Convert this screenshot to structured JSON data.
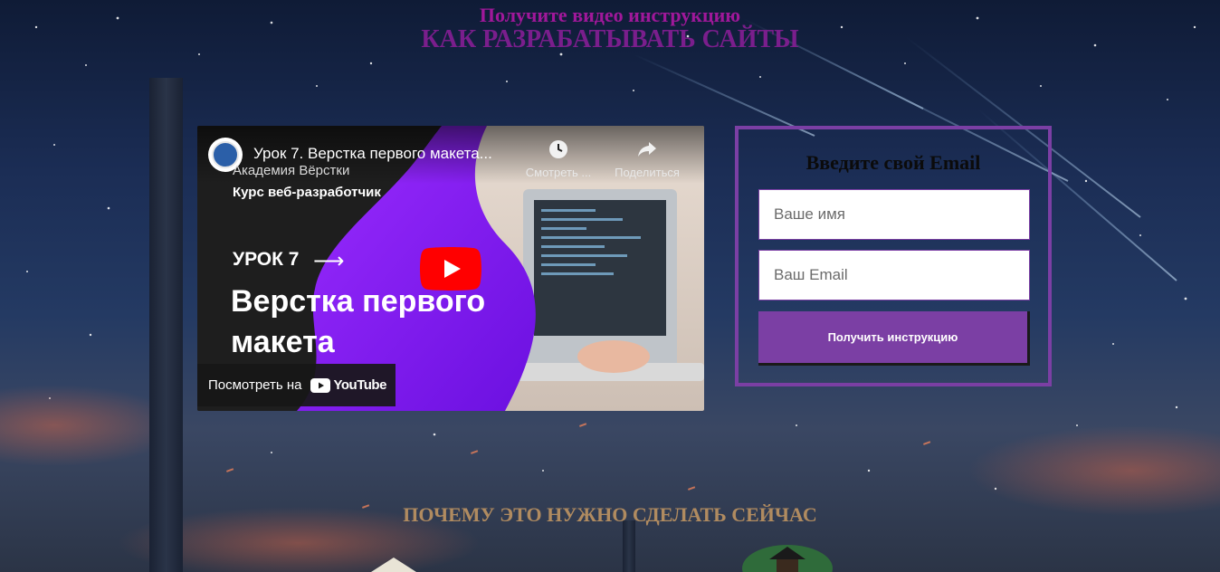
{
  "header": {
    "subtitle": "Получите видео инструкцию",
    "title": "КАК РАЗРАБАТЫВАТЬ САЙТЫ"
  },
  "video": {
    "title": "Урок 7. Верстка первого макета...",
    "channel": "Академия Вёрстки",
    "course": "Курс веб-разработчик",
    "lesson": "УРОК 7",
    "headline": "Верстка первого макета",
    "watch_later": "Смотреть ...",
    "share": "Поделиться",
    "watch_on": "Посмотреть на",
    "youtube": "YouTube"
  },
  "form": {
    "title": "Введите свой Email",
    "name_placeholder": "Ваше имя",
    "email_placeholder": "Ваш Email",
    "submit_label": "Получить инструкцию"
  },
  "section": {
    "why_title": "ПОЧЕМУ ЭТО НУЖНО СДЕЛАТЬ СЕЙЧАС"
  },
  "colors": {
    "accent": "#7b3fa4",
    "header_subtitle": "#a0189a",
    "header_title": "#7a1e8c",
    "section_title": "#b08b60"
  }
}
